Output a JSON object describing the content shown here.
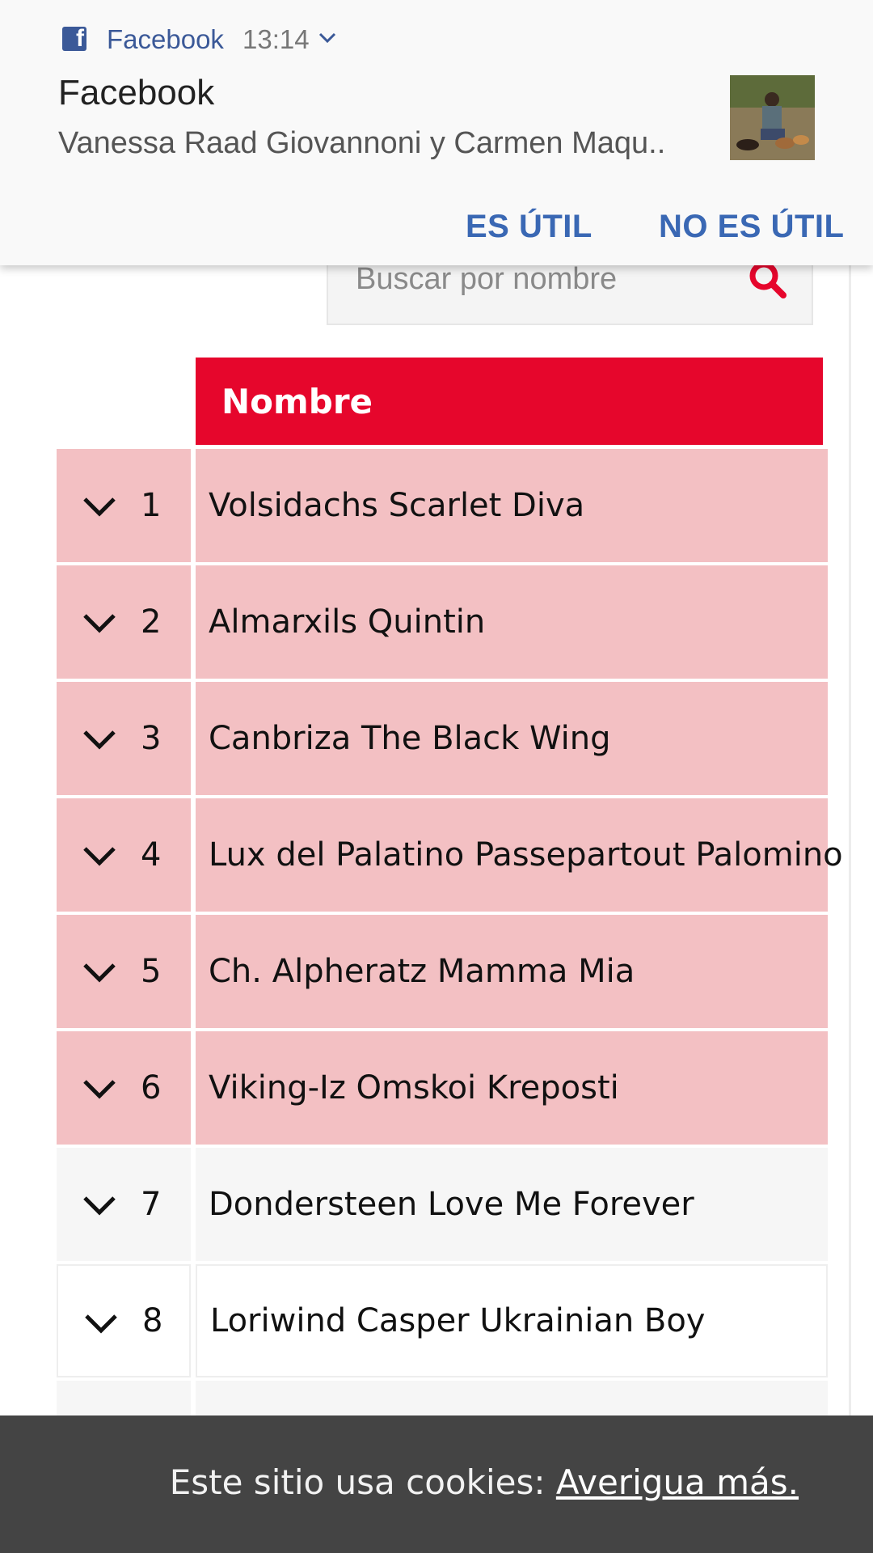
{
  "notification": {
    "app_name": "Facebook",
    "time": "13:14",
    "title": "Facebook",
    "body": "Vanessa Raad Giovannoni y Carmen Maqu..",
    "actions": {
      "useful": "ES ÚTIL",
      "not_useful": "NO ES ÚTIL"
    }
  },
  "search": {
    "placeholder": "Buscar por nombre"
  },
  "table": {
    "header": "Nombre",
    "rows": [
      {
        "num": "1",
        "name": "Volsidachs Scarlet Diva"
      },
      {
        "num": "2",
        "name": "Almarxils Quintin"
      },
      {
        "num": "3",
        "name": "Canbriza The Black Wing"
      },
      {
        "num": "4",
        "name": "Lux del Palatino Passepartout Palomino"
      },
      {
        "num": "5",
        "name": "Ch. Alpheratz Mamma Mia"
      },
      {
        "num": "6",
        "name": "Viking-Iz Omskoi Kreposti"
      },
      {
        "num": "7",
        "name": "Dondersteen Love Me Forever"
      },
      {
        "num": "8",
        "name": "Loriwind Casper Ukrainian Boy"
      }
    ]
  },
  "cookie": {
    "text": "Este sitio usa cookies:",
    "link": "Averigua más."
  },
  "colors": {
    "accent_red": "#e6062c",
    "highlight_row": "#f3c0c3",
    "facebook_blue": "#3b5998",
    "action_blue": "#3a68b4",
    "cookie_bar": "#444444"
  }
}
